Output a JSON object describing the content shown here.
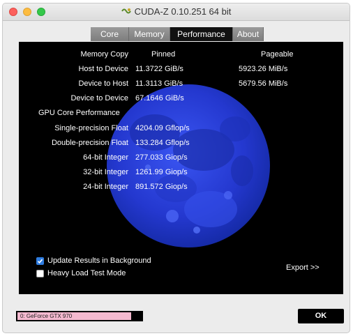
{
  "window": {
    "title": "CUDA-Z 0.10.251 64 bit"
  },
  "tabs": [
    {
      "label": "Core",
      "active": false
    },
    {
      "label": "Memory",
      "active": false
    },
    {
      "label": "Performance",
      "active": true
    },
    {
      "label": "About",
      "active": false
    }
  ],
  "performance": {
    "memory_copy": {
      "label": "Memory Copy",
      "col_pinned": "Pinned",
      "col_pageable": "Pageable",
      "rows": [
        {
          "label": "Host to Device",
          "pinned": "11.3722 GiB/s",
          "pageable": "5923.26 MiB/s"
        },
        {
          "label": "Device to Host",
          "pinned": "11.3113 GiB/s",
          "pageable": "5679.56 MiB/s"
        },
        {
          "label": "Device to Device",
          "pinned": "67.1646 GiB/s",
          "pageable": ""
        }
      ]
    },
    "gpu_core": {
      "label": "GPU Core Performance",
      "rows": [
        {
          "label": "Single-precision Float",
          "value": "4204.09 Gflop/s"
        },
        {
          "label": "Double-precision Float",
          "value": "133.284 Gflop/s"
        },
        {
          "label": "64-bit Integer",
          "value": "277.033 Giop/s"
        },
        {
          "label": "32-bit Integer",
          "value": "1261.99 Giop/s"
        },
        {
          "label": "24-bit Integer",
          "value": "891.572 Giop/s"
        }
      ]
    }
  },
  "options": {
    "update_background": {
      "label": "Update Results in Background",
      "checked": true
    },
    "heavy_load": {
      "label": "Heavy Load Test Mode",
      "checked": false
    }
  },
  "export_label": "Export >>",
  "device_selector": {
    "selected": "0: GeForce GTX 970"
  },
  "ok_label": "OK",
  "colors": {
    "panel_bg": "#000000",
    "moon_blue": "#2a3fd8",
    "active_tab": "#111111",
    "checkbox_accent": "#2f7de1",
    "device_highlight": "#f4b9cf"
  },
  "icons": {
    "app_logo": "cuda-z-logo-icon",
    "checkbox_checked": "checkmark-icon"
  }
}
